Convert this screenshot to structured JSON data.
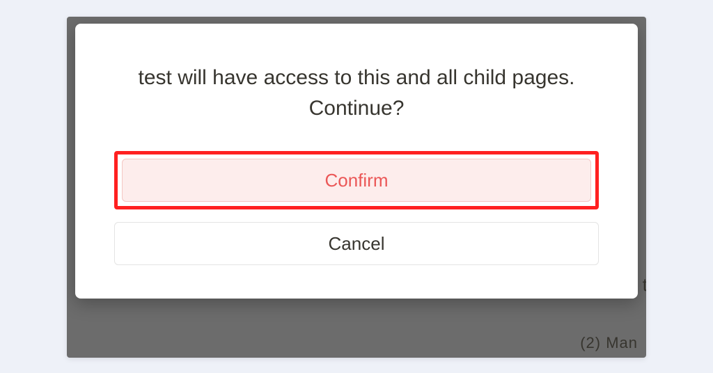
{
  "dialog": {
    "message": "test will have access to this and all child pages. Continue?",
    "confirm_label": "Confirm",
    "cancel_label": "Cancel"
  },
  "background": {
    "partial_text_bottom": "(2)  Man",
    "partial_text_mid": "t"
  }
}
